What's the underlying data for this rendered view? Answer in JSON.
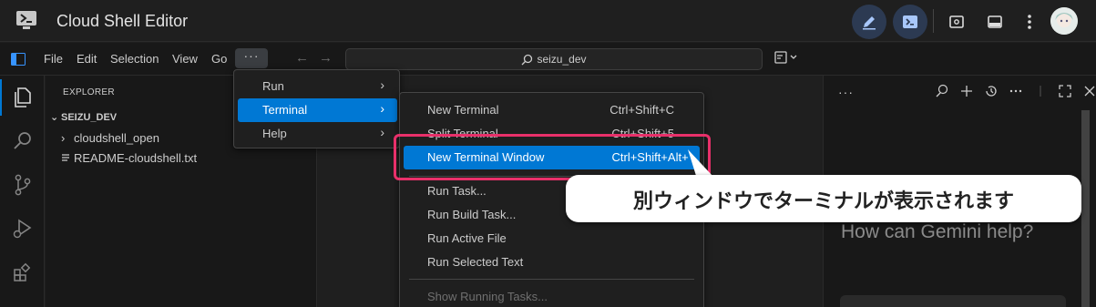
{
  "app": {
    "title": "Cloud Shell Editor",
    "accent": "#0078d4",
    "icons": [
      "cloud-shell-logo-icon",
      "edit-pencil-icon",
      "terminal-icon",
      "preview-icon",
      "layout-icon",
      "more-vert-icon",
      "avatar"
    ]
  },
  "menubar": {
    "items": [
      "File",
      "Edit",
      "Selection",
      "View",
      "Go"
    ],
    "more_label": "···",
    "search_text": "seizu_dev"
  },
  "sidebar": {
    "title": "EXPLORER",
    "root": "SEIZU_DEV",
    "items": [
      "cloudshell_open",
      "README-cloudshell.txt"
    ]
  },
  "menu_more": {
    "items": [
      {
        "label": "Run"
      },
      {
        "label": "Terminal"
      },
      {
        "label": "Help"
      }
    ]
  },
  "menu_terminal": {
    "items": [
      {
        "label": "New Terminal",
        "shortcut": "Ctrl+Shift+C"
      },
      {
        "label": "Split Terminal",
        "shortcut": "Ctrl+Shift+5"
      },
      {
        "label": "New Terminal Window",
        "shortcut": "Ctrl+Shift+Alt+`"
      },
      {
        "label": "Run Task..."
      },
      {
        "label": "Run Build Task..."
      },
      {
        "label": "Run Active File"
      },
      {
        "label": "Run Selected Text"
      },
      {
        "label": "Show Running Tasks..."
      }
    ]
  },
  "gemini": {
    "dots": "···",
    "prompt": "How can Gemini help?"
  },
  "annotation": {
    "callout": "別ウィンドウでターミナルが表示されます",
    "highlight_color": "#e8306a"
  }
}
